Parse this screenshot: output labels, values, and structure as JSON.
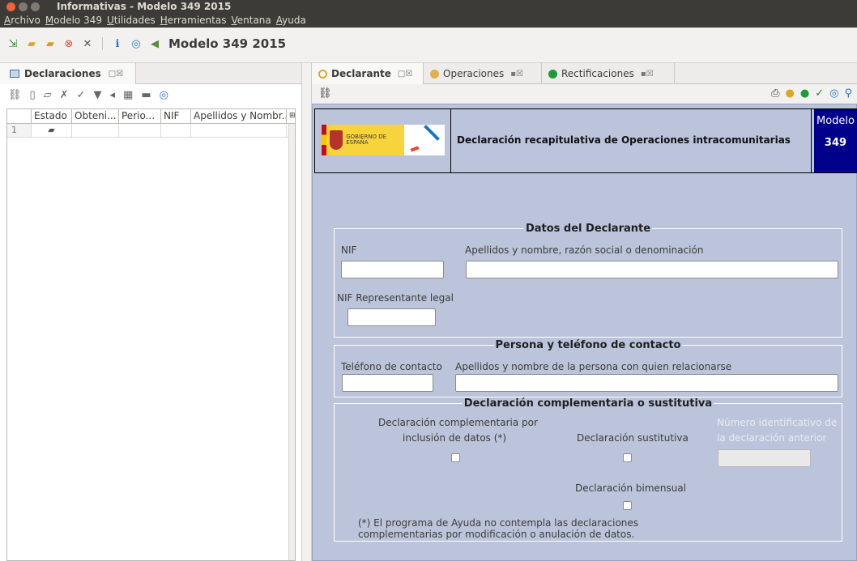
{
  "window": {
    "title": "Informativas - Modelo 349 2015"
  },
  "menubar": [
    "Archivo",
    "Modelo 349",
    "Utilidades",
    "Herramientas",
    "Ventana",
    "Ayuda"
  ],
  "main_toolbar": {
    "modelo_label": "Modelo 349 2015"
  },
  "left_panel": {
    "tab_label": "Declaraciones",
    "grid": {
      "columns": [
        "Estado",
        "Obteni...",
        "Perio...",
        "NIF",
        "Apellidos y Nombr..."
      ],
      "rows": [
        {
          "num": "1"
        }
      ]
    }
  },
  "right_panel": {
    "tabs": [
      "Declarante",
      "Operaciones",
      "Rectificaciones"
    ],
    "header": {
      "gobierno": "GOBIERNO DE ESPAÑA",
      "title": "Declaración recapitulativa de Operaciones intracomunitarias",
      "modelo_label": "Modelo",
      "modelo_number": "349"
    },
    "datos_declarante": {
      "legend": "Datos del Declarante",
      "nif_label": "NIF",
      "nombre_label": "Apellidos y nombre,  razón social o denominación",
      "nif_rep_label": "NIF Representante legal"
    },
    "contacto": {
      "legend": "Persona y teléfono de contacto",
      "telefono_label": "Teléfono de contacto",
      "persona_label": "Apellidos y nombre de la persona con quien relacionarse"
    },
    "complementaria": {
      "legend": "Declaración complementaria o sustitutiva",
      "complementaria_label_1": "Declaración complementaria por",
      "complementaria_label_2": "inclusión de datos (*)",
      "sustitutiva_label": "Declaración sustitutiva",
      "numero_label_1": "Número identificativo de",
      "numero_label_2": "la declaración anterior",
      "bimensual_label": "Declaración bimensual",
      "note_1": "(*) El programa de Ayuda no contempla las declaraciones",
      "note_2": "complementarias por modificación o anulación de datos."
    }
  }
}
